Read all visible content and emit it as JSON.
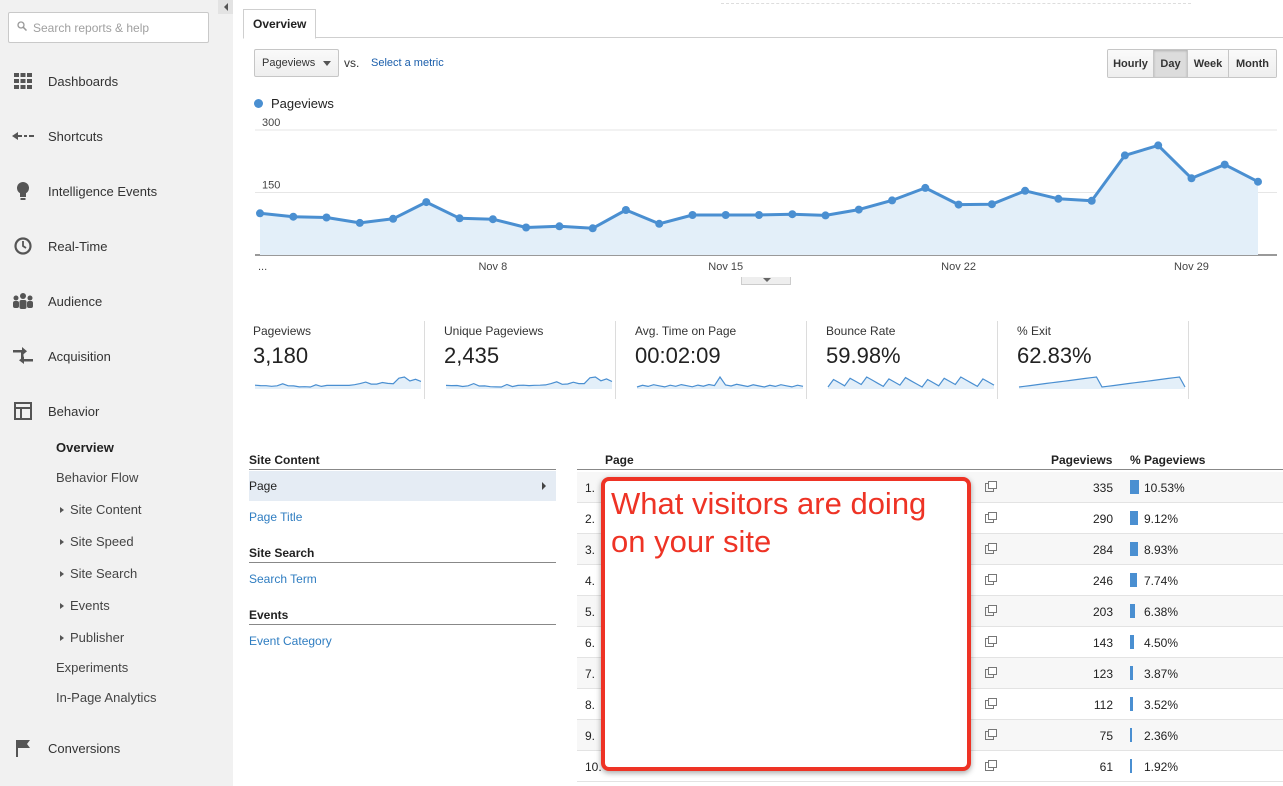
{
  "search": {
    "placeholder": "Search reports & help"
  },
  "sidebar": {
    "items": [
      {
        "label": "Dashboards",
        "icon": "grid-icon"
      },
      {
        "label": "Shortcuts",
        "icon": "shortcut-arrow-icon"
      },
      {
        "label": "Intelligence Events",
        "icon": "lightbulb-icon"
      },
      {
        "label": "Real-Time",
        "icon": "clock-icon"
      },
      {
        "label": "Audience",
        "icon": "people-icon"
      },
      {
        "label": "Acquisition",
        "icon": "arrows-icon"
      },
      {
        "label": "Behavior",
        "icon": "layout-icon"
      },
      {
        "label": "Conversions",
        "icon": "flag-icon"
      }
    ],
    "behavior_sub": [
      {
        "label": "Overview",
        "active": true,
        "expandable": false
      },
      {
        "label": "Behavior Flow",
        "active": false,
        "expandable": false
      },
      {
        "label": "Site Content",
        "active": false,
        "expandable": true
      },
      {
        "label": "Site Speed",
        "active": false,
        "expandable": true
      },
      {
        "label": "Site Search",
        "active": false,
        "expandable": true
      },
      {
        "label": "Events",
        "active": false,
        "expandable": true
      },
      {
        "label": "Publisher",
        "active": false,
        "expandable": true
      },
      {
        "label": "Experiments",
        "active": false,
        "expandable": false
      },
      {
        "label": "In-Page Analytics",
        "active": false,
        "expandable": false
      }
    ]
  },
  "tabs": {
    "overview": "Overview"
  },
  "controls": {
    "metric": "Pageviews",
    "vs": "vs.",
    "select_metric": "Select a metric",
    "periods": [
      "Hourly",
      "Day",
      "Week",
      "Month"
    ],
    "active_period": "Day"
  },
  "chart_data": {
    "type": "area",
    "series": [
      {
        "name": "Pageviews",
        "values": [
          100,
          92,
          90,
          77,
          87,
          127,
          88,
          86,
          66,
          69,
          64,
          108,
          75,
          96,
          96,
          96,
          98,
          95,
          109,
          131,
          161,
          121,
          122,
          154,
          135,
          130,
          239,
          263,
          184,
          217,
          176
        ]
      }
    ],
    "x_tick_labels": [
      "...",
      "Nov 8",
      "Nov 15",
      "Nov 22",
      "Nov 29"
    ],
    "y_tick_labels": [
      "300",
      "150"
    ],
    "ylim": [
      0,
      300
    ],
    "grid": true,
    "color": "#4a8fd1",
    "fill": "#e3eff9"
  },
  "scorecards": [
    {
      "label": "Pageviews",
      "value": "3,180"
    },
    {
      "label": "Unique Pageviews",
      "value": "2,435"
    },
    {
      "label": "Avg. Time on Page",
      "value": "00:02:09"
    },
    {
      "label": "Bounce Rate",
      "value": "59.98%"
    },
    {
      "label": "% Exit",
      "value": "62.83%"
    }
  ],
  "dimensions": {
    "site_content_header": "Site Content",
    "page": "Page",
    "page_title": "Page Title",
    "site_search_header": "Site Search",
    "search_term": "Search Term",
    "events_header": "Events",
    "event_category": "Event Category"
  },
  "table": {
    "headers": {
      "page": "Page",
      "pageviews": "Pageviews",
      "pct": "% Pageviews"
    },
    "rows": [
      {
        "num": "1.",
        "pageviews": "335",
        "pct": "10.53%",
        "share": 10.53
      },
      {
        "num": "2.",
        "pageviews": "290",
        "pct": "9.12%",
        "share": 9.12
      },
      {
        "num": "3.",
        "pageviews": "284",
        "pct": "8.93%",
        "share": 8.93
      },
      {
        "num": "4.",
        "pageviews": "246",
        "pct": "7.74%",
        "share": 7.74
      },
      {
        "num": "5.",
        "pageviews": "203",
        "pct": "6.38%",
        "share": 6.38
      },
      {
        "num": "6.",
        "pageviews": "143",
        "pct": "4.50%",
        "share": 4.5
      },
      {
        "num": "7.",
        "pageviews": "123",
        "pct": "3.87%",
        "share": 3.87
      },
      {
        "num": "8.",
        "pageviews": "112",
        "pct": "3.52%",
        "share": 3.52
      },
      {
        "num": "9.",
        "pageviews": "75",
        "pct": "2.36%",
        "share": 2.36
      },
      {
        "num": "10.",
        "pageviews": "61",
        "pct": "1.92%",
        "share": 1.92
      }
    ]
  },
  "annotation": {
    "text": "What visitors are doing on your site",
    "color": "#ee3325"
  }
}
